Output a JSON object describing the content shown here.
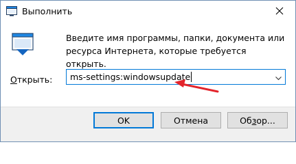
{
  "window": {
    "title": "Выполнить",
    "close_icon": "close-icon",
    "app_icon": "run-app-icon"
  },
  "dialog": {
    "description": "Введите имя программы, папки, документа или ресурса Интернета, которые требуется открыть.",
    "open_label_underlined": "О",
    "open_label_rest": "ткрыть:",
    "command_value": "ms-settings:windowsupdate"
  },
  "buttons": {
    "ok_label": "OK",
    "cancel_label": "Отмена",
    "browse_label_before": "Об",
    "browse_label_underlined": "з",
    "browse_label_after": "ор..."
  },
  "colors": {
    "accent": "#0078d7",
    "annotation_arrow": "#e3242b",
    "footer_bg": "#f0f0f0"
  }
}
